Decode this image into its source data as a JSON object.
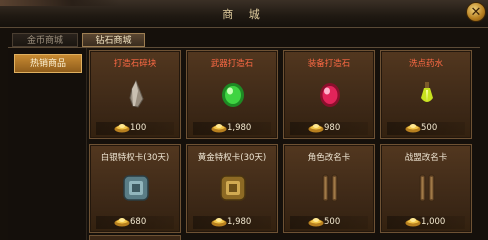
{
  "window": {
    "title": "商 城"
  },
  "tabs": [
    {
      "label": "金币商城"
    },
    {
      "label": "钻石商城"
    }
  ],
  "sidebar": {
    "selected_label": "热销商品"
  },
  "items": [
    {
      "name": "打造石碎块",
      "price": "100",
      "icon": "stone-shard-icon"
    },
    {
      "name": "武器打造石",
      "price": "1,980",
      "icon": "green-gem-icon"
    },
    {
      "name": "装备打造石",
      "price": "980",
      "icon": "red-gem-icon"
    },
    {
      "name": "洗点药水",
      "price": "500",
      "icon": "potion-icon"
    },
    {
      "name": "白银特权卡(30天)",
      "price": "680",
      "icon": "silver-card-icon"
    },
    {
      "name": "黄金特权卡(30天)",
      "price": "1,980",
      "icon": "gold-card-icon"
    },
    {
      "name": "角色改名卡",
      "price": "500",
      "icon": "scroll-icon"
    },
    {
      "name": "战盟改名卡",
      "price": "1,000",
      "icon": "scroll-icon"
    }
  ],
  "colors": {
    "name_red": "#ff6a45",
    "name_white": "#efe6d4",
    "tab_active": "#5a4631",
    "sidebar_active": "#c88a32"
  }
}
